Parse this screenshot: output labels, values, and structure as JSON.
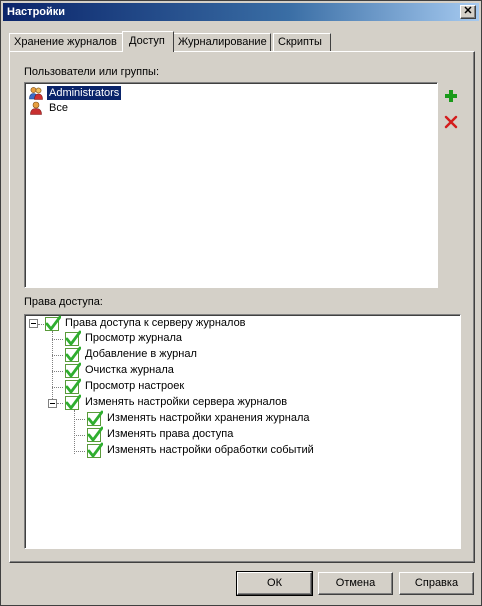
{
  "window": {
    "title": "Настройки",
    "close_glyph": "✕"
  },
  "tabs": [
    {
      "label": "Хранение журналов"
    },
    {
      "label": "Доступ"
    },
    {
      "label": "Журналирование"
    },
    {
      "label": "Скрипты"
    }
  ],
  "active_tab": "Доступ",
  "users": {
    "label": "Пользователи или группы:",
    "items": [
      {
        "name": "Administrators",
        "selected": true,
        "icon": "group-icon"
      },
      {
        "name": "Все",
        "selected": false,
        "icon": "user-icon"
      }
    ],
    "add_icon": "plus-icon",
    "remove_icon": "delete-x-icon"
  },
  "permissions": {
    "label": "Права доступа:",
    "tree": [
      {
        "label": "Права доступа к серверу журналов",
        "checked": true,
        "expanded": true
      },
      {
        "label": "Просмотр журнала",
        "checked": true
      },
      {
        "label": "Добавление в журнал",
        "checked": true
      },
      {
        "label": "Очистка журнала",
        "checked": true
      },
      {
        "label": "Просмотр настроек",
        "checked": true
      },
      {
        "label": "Изменять настройки сервера журналов",
        "checked": true,
        "expanded": true
      },
      {
        "label": "Изменять настройки хранения журнала",
        "checked": true
      },
      {
        "label": "Изменять права доступа",
        "checked": true
      },
      {
        "label": "Изменять настройки обработки событий",
        "checked": true
      }
    ]
  },
  "buttons": {
    "ok": "ОК",
    "cancel": "Отмена",
    "help": "Справка"
  },
  "colors": {
    "title_bg": "#0a246a",
    "selection": "#0a246a",
    "check": "#2fae2f",
    "add": "#1a9a1a",
    "remove": "#d41c1c"
  }
}
